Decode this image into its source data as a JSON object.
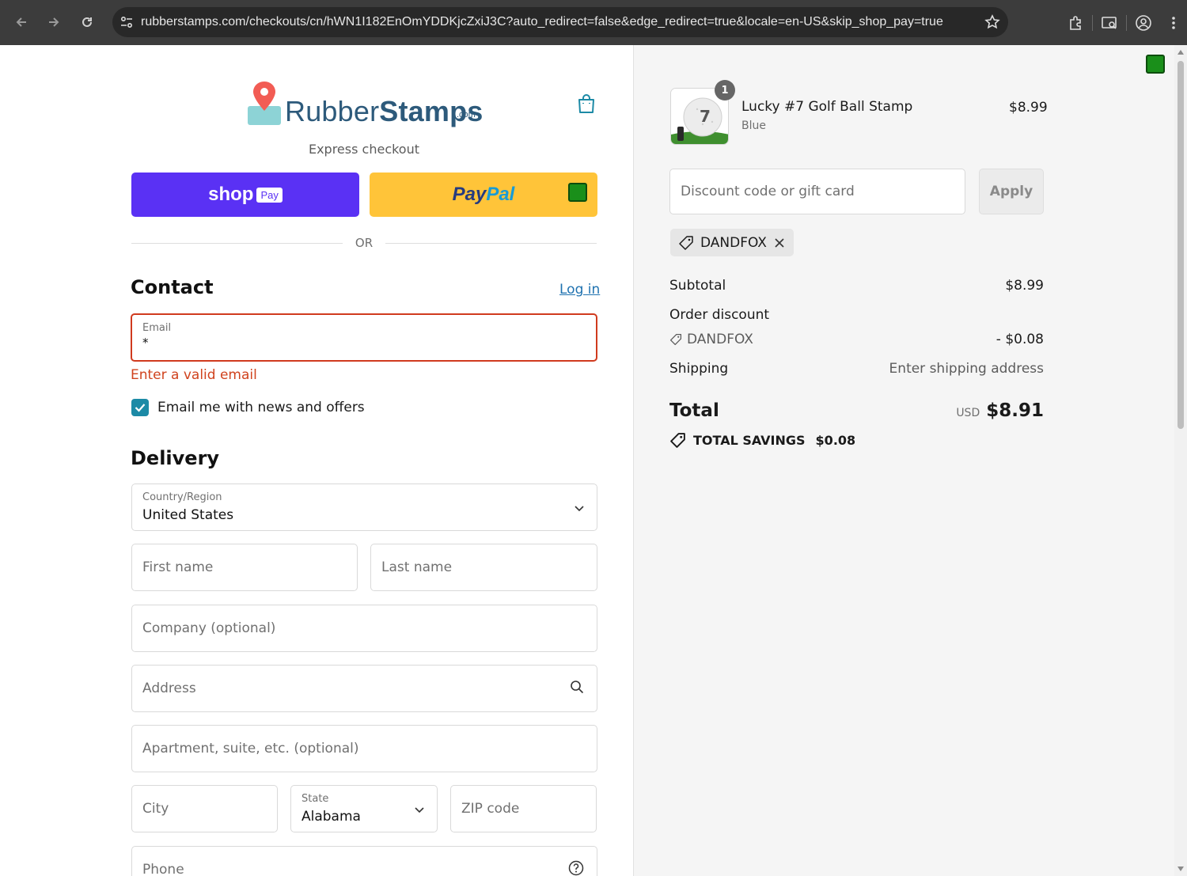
{
  "browser": {
    "url": "rubberstamps.com/checkouts/cn/hWN1I182EnOmYDDKjcZxiJ3C?auto_redirect=false&edge_redirect=true&locale=en-US&skip_shop_pay=true"
  },
  "brand": {
    "name_light": "Rubber",
    "name_bold": "Stamps",
    "suffix": ".com",
    "color": "#2d5a7b"
  },
  "express": {
    "label": "Express checkout",
    "shop_word": "shop",
    "shop_pay": "Pay",
    "paypal_1": "Pay",
    "paypal_2": "Pal",
    "or": "OR"
  },
  "contact": {
    "heading": "Contact",
    "login": "Log in",
    "email_label": "Email",
    "email_required": "*",
    "error": "Enter a valid email",
    "newsletter": "Email me with news and offers",
    "newsletter_checked": true
  },
  "delivery": {
    "heading": "Delivery",
    "country_label": "Country/Region",
    "country_value": "United States",
    "first_name": "First name",
    "last_name": "Last name",
    "company": "Company (optional)",
    "address": "Address",
    "apartment": "Apartment, suite, etc. (optional)",
    "city": "City",
    "state_label": "State",
    "state_value": "Alabama",
    "zip": "ZIP code",
    "phone": "Phone"
  },
  "summary": {
    "item": {
      "qty": "1",
      "name": "Lucky #7 Golf Ball Stamp",
      "variant": "Blue",
      "price": "$8.99"
    },
    "discount_placeholder": "Discount code or gift card",
    "apply": "Apply",
    "code": "DANDFOX",
    "subtotal_label": "Subtotal",
    "subtotal_value": "$8.99",
    "order_discount_label": "Order discount",
    "discount_code": "DANDFOX",
    "discount_value": "- $0.08",
    "shipping_label": "Shipping",
    "shipping_value": "Enter shipping address",
    "total_label": "Total",
    "total_currency": "USD",
    "total_value": "$8.91",
    "savings_label": "TOTAL SAVINGS",
    "savings_value": "$0.08"
  },
  "colors": {
    "shop_pay": "#5a31f4",
    "paypal": "#ffc439",
    "error": "#d03a1e",
    "link": "#1f72b0",
    "checkbox": "#1c8aa6"
  }
}
